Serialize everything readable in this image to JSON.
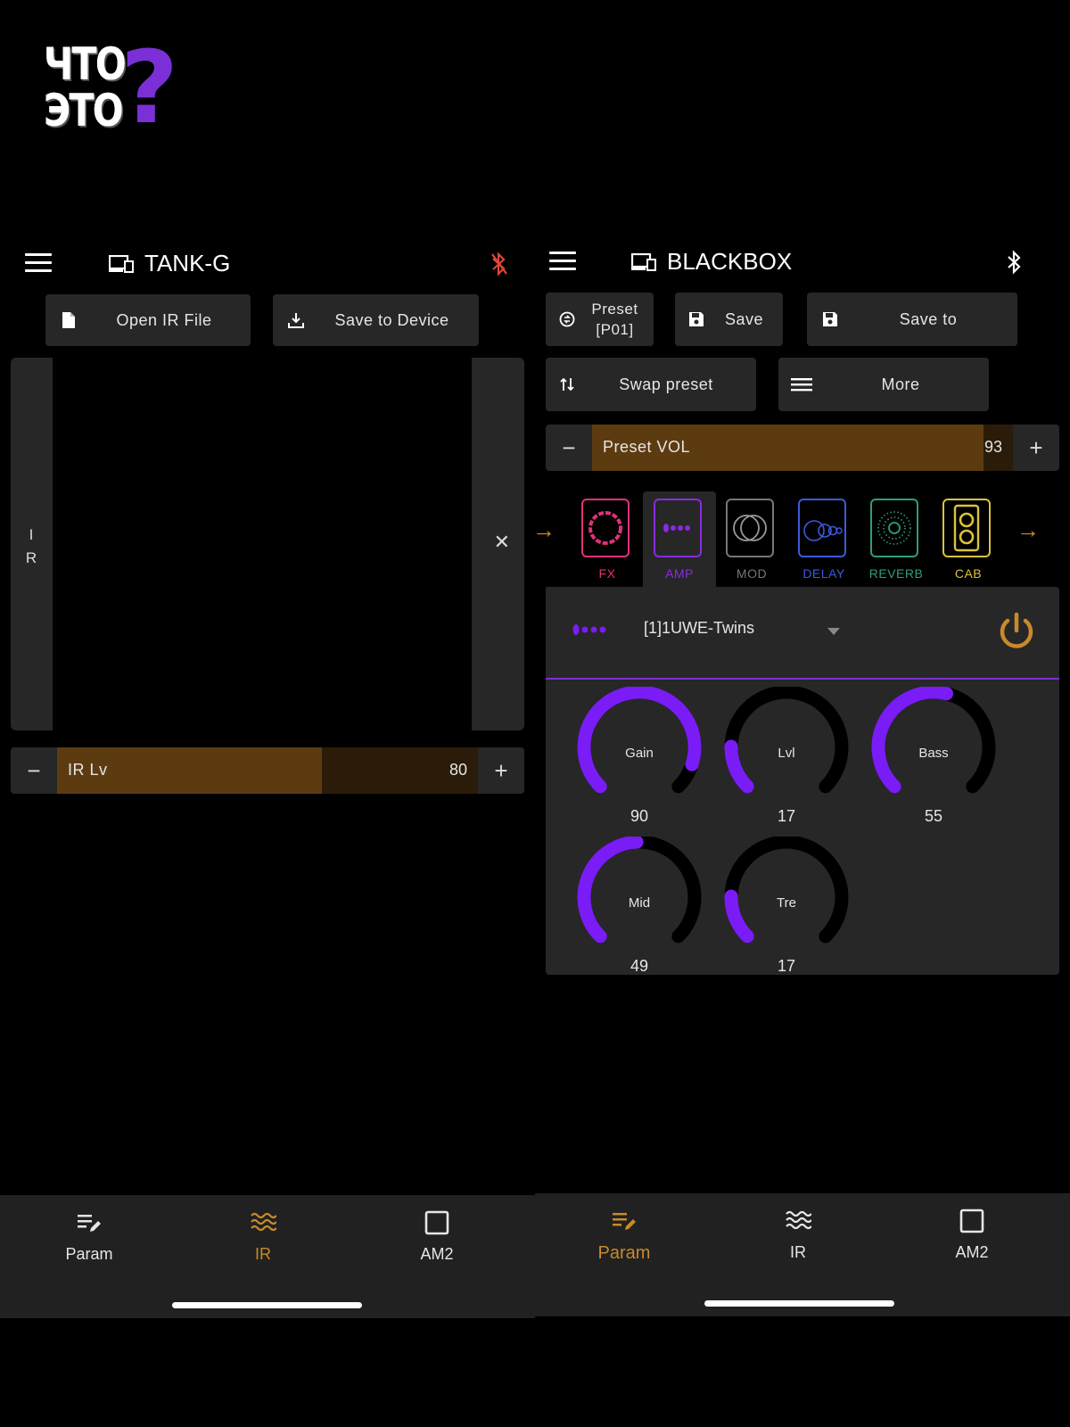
{
  "logo": {
    "line1": "ЧТО",
    "line2": "ЭТО",
    "mark": "?"
  },
  "left": {
    "device_name": "TANK-G",
    "bluetooth_color": "#e0463a",
    "buttons": {
      "open_ir": "Open IR File",
      "save_device": "Save to Device"
    },
    "ir_side_label_1": "I",
    "ir_side_label_2": "R",
    "ir_close": "✕",
    "ir_level": {
      "label": "IR Lv",
      "value": "80",
      "fraction": 0.63,
      "minus": "−",
      "plus": "+"
    },
    "nav": [
      {
        "label": "Param",
        "icon": "edit-list-icon",
        "active": false
      },
      {
        "label": "IR",
        "icon": "waves-icon",
        "active": true
      },
      {
        "label": "AM2",
        "icon": "square-icon",
        "active": false
      }
    ]
  },
  "right": {
    "device_name": "BLACKBOX",
    "bluetooth_color": "#ffffff",
    "buttons": {
      "preset_line1": "Preset",
      "preset_line2": "[P01]",
      "save": "Save",
      "save_to": "Save to",
      "swap": "Swap preset",
      "more": "More"
    },
    "preset_vol": {
      "label": "Preset VOL",
      "value": "93",
      "fraction": 0.93,
      "minus": "−",
      "plus": "+"
    },
    "modules": [
      {
        "label": "FX",
        "color": "#e0317a"
      },
      {
        "label": "AMP",
        "color": "#8a2be2"
      },
      {
        "label": "MOD",
        "color": "#777777"
      },
      {
        "label": "DELAY",
        "color": "#3b5bdb"
      },
      {
        "label": "REVERB",
        "color": "#2e9e7a"
      },
      {
        "label": "CAB",
        "color": "#d9c33a"
      }
    ],
    "amp": {
      "model": "[1]1UWE-Twins",
      "accent": "#7a1cf5",
      "power_color": "#c88a2a",
      "knobs": [
        {
          "label": "Gain",
          "value": "90",
          "level": 90
        },
        {
          "label": "Lvl",
          "value": "17",
          "level": 17
        },
        {
          "label": "Bass",
          "value": "55",
          "level": 55
        },
        {
          "label": "Mid",
          "value": "49",
          "level": 49
        },
        {
          "label": "Tre",
          "value": "17",
          "level": 17
        }
      ]
    },
    "nav": [
      {
        "label": "Param",
        "icon": "edit-list-icon",
        "active": true
      },
      {
        "label": "IR",
        "icon": "waves-icon",
        "active": false
      },
      {
        "label": "AM2",
        "icon": "square-icon",
        "active": false
      }
    ]
  },
  "colors": {
    "accent_orange": "#c88a2a",
    "nav_active": "#c88a2a",
    "nav_inactive": "#e6e6e6"
  }
}
